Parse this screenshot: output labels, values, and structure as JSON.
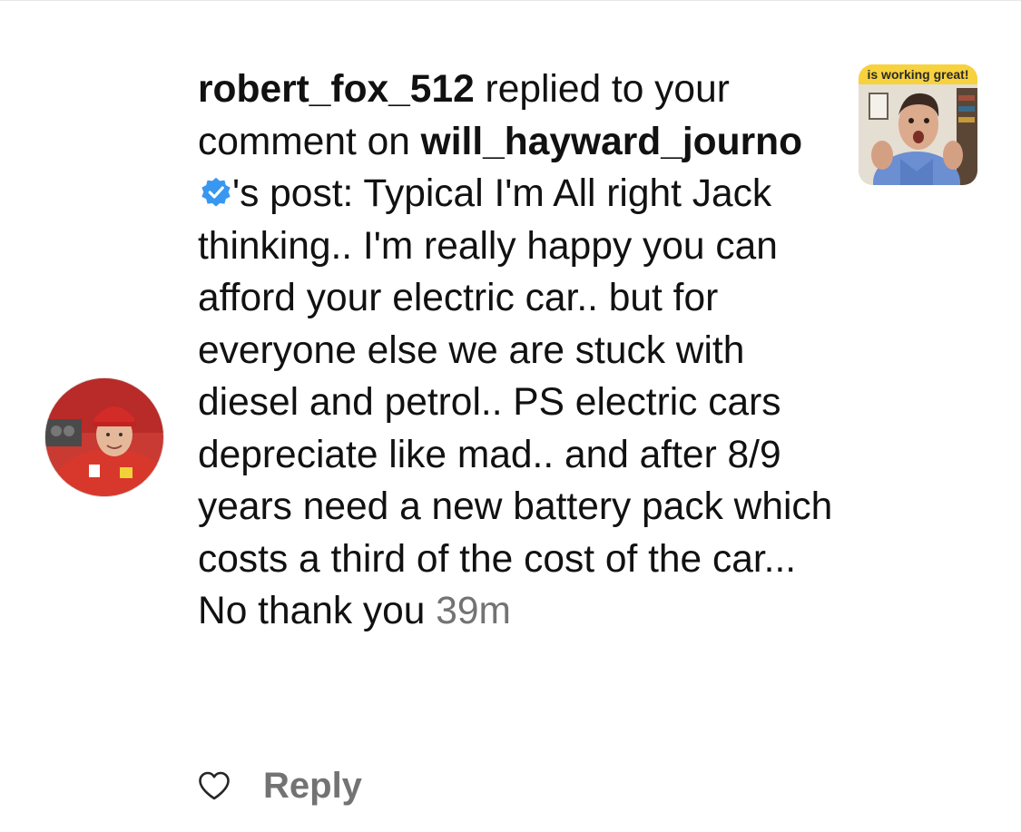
{
  "notification": {
    "actor_username": "robert_fox_512",
    "action_text": " replied to your comment on ",
    "post_owner": "will_hayward_journo",
    "possessive": "'s post: ",
    "comment_text": "Typical I'm All right Jack thinking.. I'm really happy you can afford your electric car.. but for everyone else we are stuck with diesel and petrol.. PS electric cars depreciate like mad.. and after 8/9 years need a new battery pack which costs a third of the cost of the car... No thank you",
    "time_ago": "39m",
    "verified_icon": "verified-badge-icon",
    "verified_color": "#3897f0"
  },
  "thumbnail": {
    "caption": "is working great!"
  },
  "actions": {
    "like_icon": "heart-outline-icon",
    "reply_label": "Reply"
  },
  "colors": {
    "text": "#111111",
    "secondary": "#737373",
    "accent_yellow": "#f7d23e"
  }
}
